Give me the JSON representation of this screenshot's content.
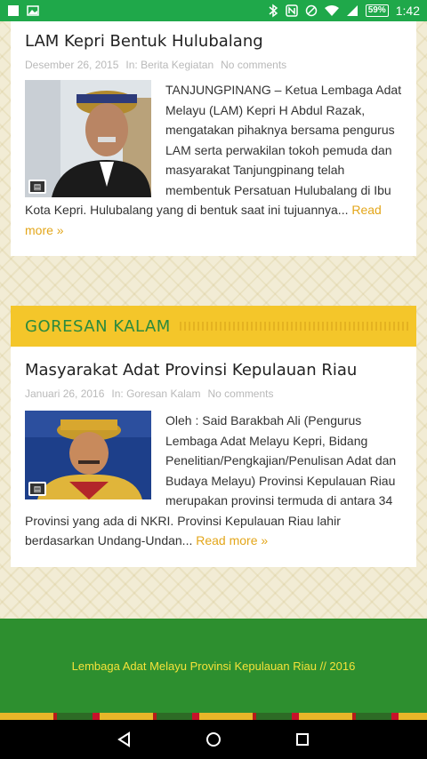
{
  "status_bar": {
    "battery": "59%",
    "time": "1:42",
    "icons": [
      "notification-square-icon",
      "image-icon",
      "bluetooth-icon",
      "nfc-icon",
      "do-not-disturb-icon",
      "wifi-icon",
      "signal-icon",
      "battery-icon"
    ]
  },
  "posts": [
    {
      "title": "LAM Kepri Bentuk Hulubalang",
      "date": "Desember 26, 2015",
      "category": "In: Berita Kegiatan",
      "comments": "No comments",
      "excerpt": "TANJUNGPINANG – Ketua Lembaga Adat Melayu (LAM) Kepri H Abdul Razak, mengatakan pihaknya bersama pengurus LAM serta perwakilan tokoh pemuda dan masyarakat Tanjungpinang telah membentuk Persatuan Hulubalang di Ibu Kota Kepri. Hulubalang yang di bentuk saat ini tujuannya...",
      "read_more": "Read more »"
    },
    {
      "title": "Masyarakat Adat Provinsi Kepulauan Riau",
      "date": "Januari 26, 2016",
      "category": "In: Goresan Kalam",
      "comments": "No comments",
      "excerpt": "Oleh : Said Barakbah Ali (Pengurus Lembaga Adat Melayu Kepri, Bidang Penelitian/Pengkajian/Penulisan Adat dan Budaya Melayu) Provinsi Kepulauan Riau merupakan provinsi termuda di antara 34 Provinsi yang ada di NKRI. Provinsi Kepulauan Riau lahir berdasarkan Undang-Undan...",
      "read_more": "Read more »"
    }
  ],
  "section": {
    "label": "GORESAN KALAM"
  },
  "footer": {
    "text": "Lembaga Adat Melayu Provinsi Kepulauan Riau // 2016"
  },
  "colors": {
    "status_bar": "#1fa84a",
    "section_header": "#f4c62a",
    "section_text": "#2b8a3e",
    "footer": "#2d8f2f",
    "footer_text": "#f4e23a",
    "read_more": "#e3a61a"
  }
}
